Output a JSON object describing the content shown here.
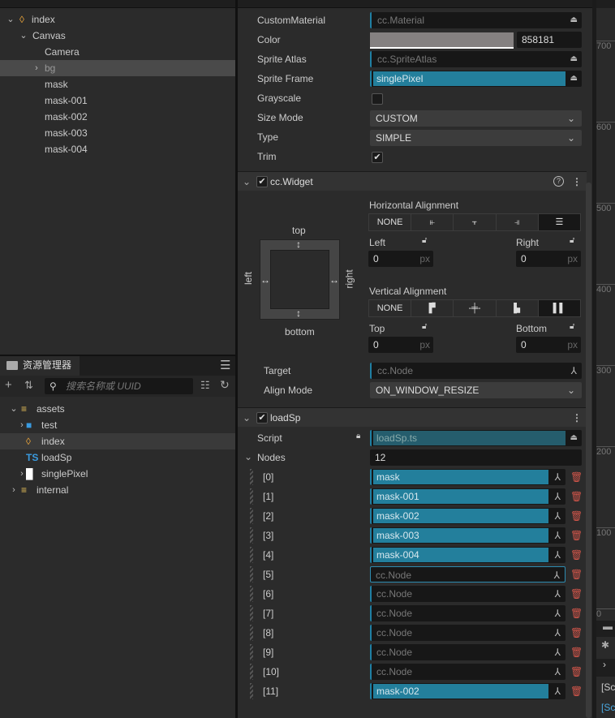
{
  "hierarchy": {
    "items": [
      {
        "label": "index",
        "depth": 0,
        "expanded": true,
        "icon": "scene-icon"
      },
      {
        "label": "Canvas",
        "depth": 1,
        "expanded": true
      },
      {
        "label": "Camera",
        "depth": 2
      },
      {
        "label": "bg",
        "depth": 2,
        "collapsed": true,
        "selected": true
      },
      {
        "label": "mask",
        "depth": 2
      },
      {
        "label": "mask-001",
        "depth": 2
      },
      {
        "label": "mask-002",
        "depth": 2
      },
      {
        "label": "mask-003",
        "depth": 2
      },
      {
        "label": "mask-004",
        "depth": 2
      }
    ]
  },
  "assets": {
    "tab_label": "资源管理器",
    "search_placeholder": "搜索名称或 UUID",
    "items": [
      {
        "label": "assets",
        "depth": 0,
        "expanded": true,
        "icon": "database-icon"
      },
      {
        "label": "test",
        "depth": 1,
        "collapsed": true,
        "icon": "folder-icon"
      },
      {
        "label": "index",
        "depth": 1,
        "icon": "scene-icon",
        "selected": true
      },
      {
        "label": "loadSp",
        "depth": 1,
        "icon": "ts-icon",
        "badge": "TS"
      },
      {
        "label": "singlePixel",
        "depth": 1,
        "collapsed": true,
        "icon": "image-icon"
      },
      {
        "label": "internal",
        "depth": 0,
        "collapsed": true,
        "icon": "database-icon"
      }
    ]
  },
  "sprite": {
    "custom_material_label": "CustomMaterial",
    "custom_material_value": "cc.Material",
    "color_label": "Color",
    "color_hex": "858181",
    "color_swatch": "#858181",
    "sprite_atlas_label": "Sprite Atlas",
    "sprite_atlas_value": "cc.SpriteAtlas",
    "sprite_frame_label": "Sprite Frame",
    "sprite_frame_value": "singlePixel",
    "grayscale_label": "Grayscale",
    "grayscale_checked": false,
    "size_mode_label": "Size Mode",
    "size_mode_value": "CUSTOM",
    "type_label": "Type",
    "type_value": "SIMPLE",
    "trim_label": "Trim",
    "trim_checked": true
  },
  "widget": {
    "title": "cc.Widget",
    "enabled": true,
    "diagram": {
      "top": "top",
      "bottom": "bottom",
      "left": "left",
      "right": "right"
    },
    "h_align_label": "Horizontal Alignment",
    "none_label": "NONE",
    "left_label": "Left",
    "left_value": "0",
    "right_label": "Right",
    "right_value": "0",
    "unit": "px",
    "v_align_label": "Vertical Alignment",
    "top_label": "Top",
    "top_value": "0",
    "bottom_label": "Bottom",
    "bottom_value": "0",
    "target_label": "Target",
    "target_value": "cc.Node",
    "align_mode_label": "Align Mode",
    "align_mode_value": "ON_WINDOW_RESIZE"
  },
  "loadsp": {
    "title": "loadSp",
    "enabled": true,
    "script_label": "Script",
    "script_value": "loadSp.ts",
    "nodes_label": "Nodes",
    "nodes_count": "12",
    "nodes": [
      {
        "index": "[0]",
        "value": "mask",
        "set": true
      },
      {
        "index": "[1]",
        "value": "mask-001",
        "set": true
      },
      {
        "index": "[2]",
        "value": "mask-002",
        "set": true
      },
      {
        "index": "[3]",
        "value": "mask-003",
        "set": true
      },
      {
        "index": "[4]",
        "value": "mask-004",
        "set": true
      },
      {
        "index": "[5]",
        "value": "cc.Node",
        "set": false
      },
      {
        "index": "[6]",
        "value": "cc.Node",
        "set": false
      },
      {
        "index": "[7]",
        "value": "cc.Node",
        "set": false
      },
      {
        "index": "[8]",
        "value": "cc.Node",
        "set": false
      },
      {
        "index": "[9]",
        "value": "cc.Node",
        "set": false
      },
      {
        "index": "[10]",
        "value": "cc.Node",
        "set": false
      },
      {
        "index": "[11]",
        "value": "mask-002",
        "set": true
      }
    ]
  },
  "ruler": {
    "ticks": [
      "700",
      "600",
      "500",
      "400",
      "300",
      "200",
      "100",
      "0"
    ]
  },
  "console": {
    "lines": [
      "[Sc",
      "[Sc"
    ]
  }
}
